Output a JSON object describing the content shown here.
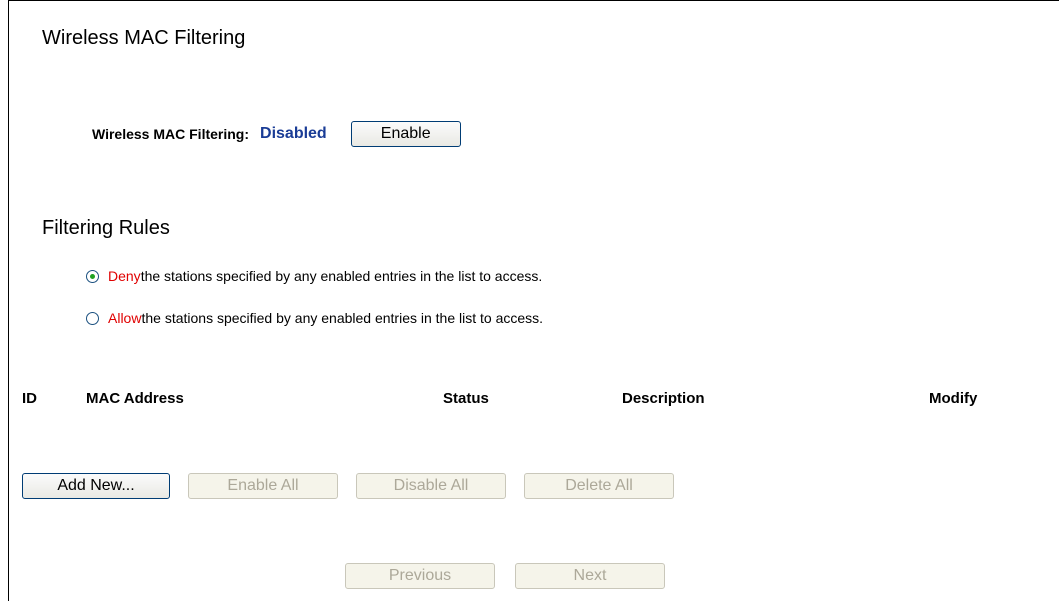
{
  "title": "Wireless MAC Filtering",
  "mac_filter": {
    "label": "Wireless MAC Filtering:",
    "status": "Disabled",
    "enable_button": "Enable"
  },
  "filtering_rules": {
    "title": "Filtering Rules",
    "options": [
      {
        "keyword": "Deny",
        "text": " the stations specified by any enabled entries in the list to access.",
        "selected": true
      },
      {
        "keyword": "Allow",
        "text": " the stations specified by any enabled entries in the list to access.",
        "selected": false
      }
    ]
  },
  "table": {
    "headers": {
      "id": "ID",
      "mac": "MAC Address",
      "status": "Status",
      "description": "Description",
      "modify": "Modify"
    }
  },
  "actions": {
    "add_new": "Add New...",
    "enable_all": "Enable All",
    "disable_all": "Disable All",
    "delete_all": "Delete All"
  },
  "pager": {
    "previous": "Previous",
    "next": "Next"
  }
}
